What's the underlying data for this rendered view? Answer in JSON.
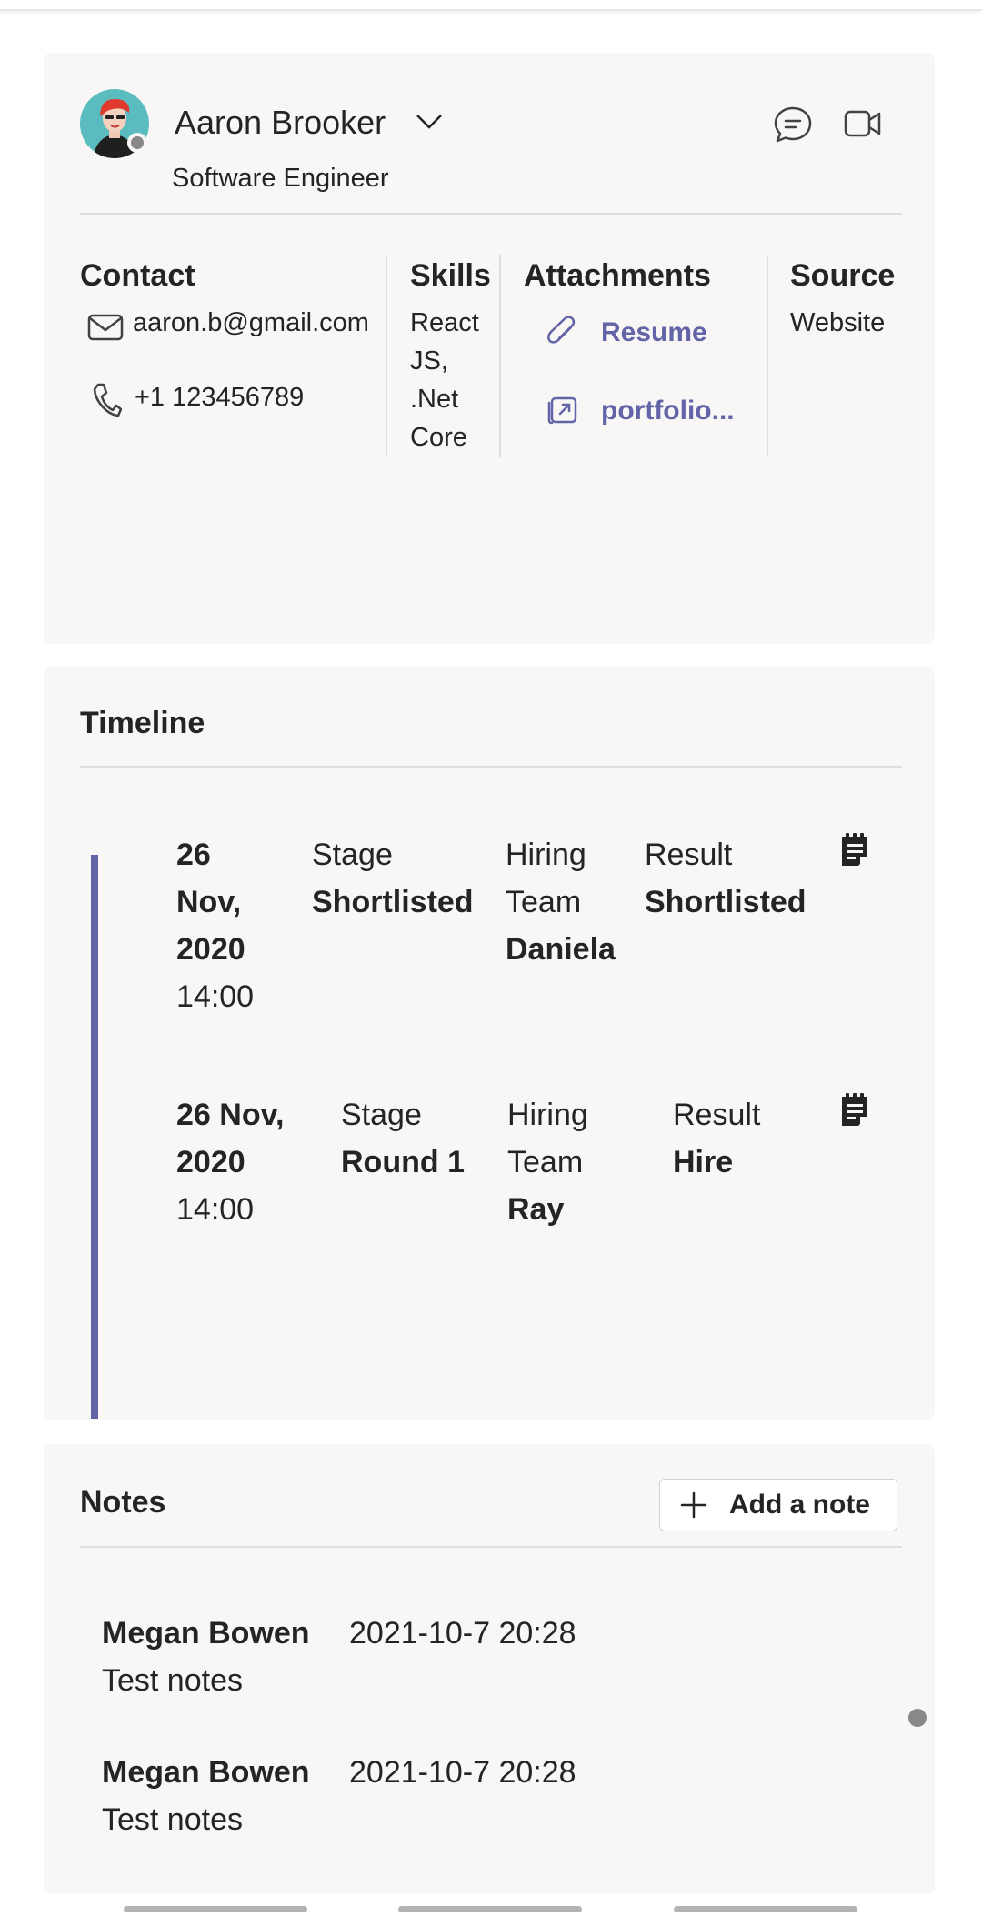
{
  "profile": {
    "name": "Aaron Brooker",
    "role": "Software Engineer",
    "contact": {
      "heading": "Contact",
      "email": "aaron.b@gmail.com",
      "phone": "+1 123456789"
    },
    "skills": {
      "heading": "Skills",
      "lines": [
        "React",
        "JS,",
        ".Net",
        "Core"
      ]
    },
    "attachments": {
      "heading": "Attachments",
      "resume": "Resume",
      "portfolio": "portfolio..."
    },
    "source": {
      "heading": "Source",
      "value": "Website"
    }
  },
  "timeline": {
    "title": "Timeline",
    "entries": [
      {
        "date_lines": [
          "26",
          "Nov,",
          "2020"
        ],
        "time": "14:00",
        "stage_label": "Stage",
        "stage": "Shortlisted",
        "team_label_lines": [
          "Hiring",
          "Team"
        ],
        "team": "Daniela",
        "result_label": "Result",
        "result": "Shortlisted"
      },
      {
        "date_lines": [
          "26 Nov,",
          "2020"
        ],
        "time": "14:00",
        "stage_label": "Stage",
        "stage": "Round 1",
        "team_label_lines": [
          "Hiring",
          "Team"
        ],
        "team": "Ray",
        "result_label": "Result",
        "result": "Hire"
      }
    ]
  },
  "notes": {
    "title": "Notes",
    "add_label": "Add a note",
    "items": [
      {
        "author": "Megan Bowen",
        "time": "2021-10-7 20:28",
        "text": "Test notes"
      },
      {
        "author": "Megan Bowen",
        "time": "2021-10-7 20:28",
        "text": "Test notes"
      }
    ]
  },
  "colors": {
    "accent": "#6264a7",
    "card": "#f8f7f6",
    "text": "#242424"
  }
}
